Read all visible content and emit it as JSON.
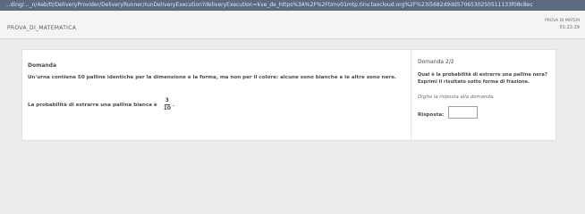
{
  "browser": {
    "url": "...ding/..._n/4eb/tt/DeliveryProvider/DeliveryRunner/runDeliveryExecution?deliveryExecution=kve_de_https%3A%2F%2Ftimv01mtp.tinv.taocloud.org%2F%23i5682d9dd5706530250511133f08c8ec"
  },
  "header": {
    "test_name": "PROVA_DI_MATEMATICA",
    "right_label": "PROVA DI MATEM",
    "timer": "01:22:29"
  },
  "stimulus": {
    "title": "Domanda",
    "text": "Un'urna contiene 50 palline identiche per la dimensione e la forma, ma non per il colore: alcune sono bianche e le altre sono nere.",
    "probability_text": "La probabilità di estrarre una pallina bianca è",
    "fraction_numerator": "3",
    "fraction_denominator": "10",
    "fraction_suffix": "."
  },
  "question": {
    "title": "Domanda 2/2",
    "text": "Qual è la probabilità di estrarre una pallina nera? Esprimi il risultato sotto forma di frazione.",
    "instruction": "Digita la risposta alla domanda.",
    "answer_label": "Risposta:",
    "answer_value": ""
  }
}
